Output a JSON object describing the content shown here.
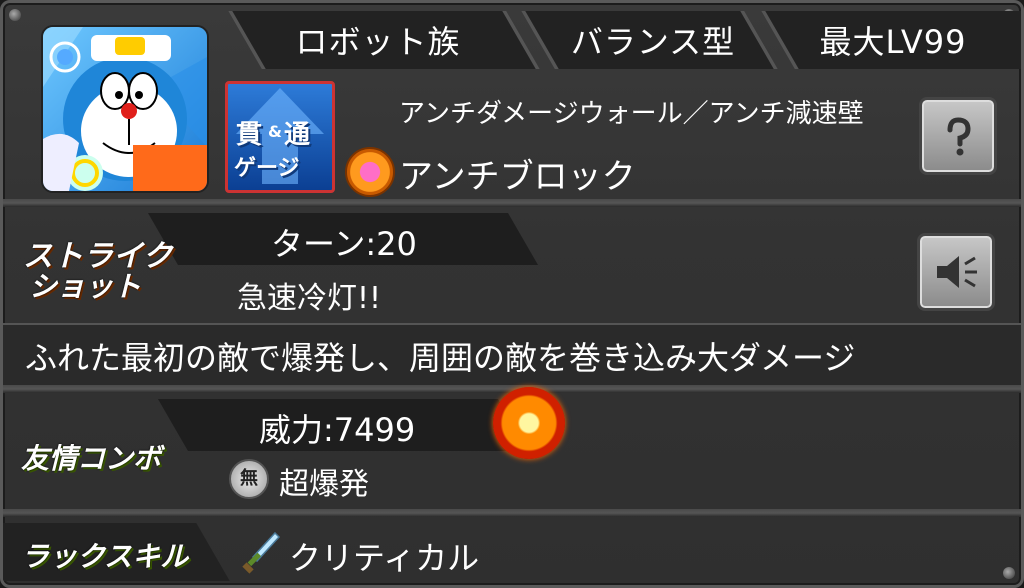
{
  "header": {
    "tribe": "ロボット族",
    "type": "バランス型",
    "max_level": "最大LV99"
  },
  "abilities": {
    "gauge_badge_line1": "貫",
    "gauge_badge_amp": "&",
    "gauge_badge_line2": "通",
    "gauge_badge_line3": "ゲージ",
    "gauge_ability": "アンチダメージウォール／アンチ減速壁",
    "main_ability": "アンチブロック"
  },
  "strike_shot": {
    "label_line1": "ストライク",
    "label_line2": "ショット",
    "turns": "ターン:20",
    "name": "急速冷灯!!",
    "description": "ふれた最初の敵で爆発し、周囲の敵を巻き込み大ダメージ"
  },
  "friendship_combo": {
    "label": "友情コンボ",
    "power": "威力:7499",
    "attribute_badge": "無",
    "name": "超爆発"
  },
  "luck_skill": {
    "label": "ラックスキル",
    "name": "クリティカル"
  },
  "icons": [
    "character-portrait",
    "help-icon",
    "speaker-icon",
    "explosion-icon",
    "sword-icon",
    "anti-block-icon"
  ]
}
